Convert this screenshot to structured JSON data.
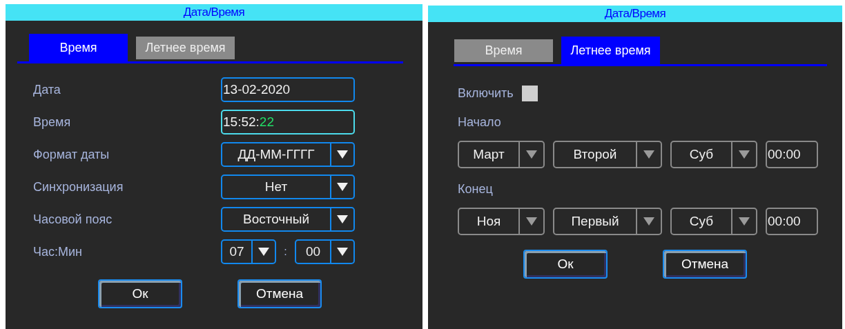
{
  "panels": [
    {
      "kind": "time",
      "title": "Дата/Время",
      "tabs": [
        {
          "label": "Время",
          "selected": true
        },
        {
          "label": "Летнее время",
          "selected": false
        }
      ],
      "fields": [
        {
          "label": "Дата",
          "kind": "text",
          "value": "13-02-2020",
          "focused": false
        },
        {
          "label": "Время",
          "kind": "text",
          "value": "15:52:",
          "active_segment": "22",
          "focused": true
        },
        {
          "label": "Формат даты",
          "kind": "select",
          "value": "ДД-ММ-ГГГГ",
          "focused": false
        },
        {
          "label": "Синхронизация",
          "kind": "select",
          "value": "Нет",
          "focused": false
        },
        {
          "label": "Часовой пояс",
          "kind": "select",
          "value": "Восточный",
          "focused": false
        },
        {
          "label": "Час:Мин",
          "kind": "pair",
          "values": [
            "07",
            "00"
          ],
          "separator": ":",
          "focused": false
        }
      ],
      "buttons": [
        "Ок",
        "Отмена"
      ]
    },
    {
      "kind": "dst",
      "title": "Дата/Время",
      "tabs": [
        {
          "label": "Время",
          "selected": false
        },
        {
          "label": "Летнее время",
          "selected": true
        }
      ],
      "enable": {
        "label": "Включить",
        "checked": false
      },
      "groups": [
        {
          "label": "Начало",
          "selects": [
            "Март",
            "Второй",
            "Суб"
          ],
          "time": "00:00"
        },
        {
          "label": "Конец",
          "selects": [
            "Ноя",
            "Первый",
            "Суб"
          ],
          "time": "00:00"
        }
      ],
      "buttons": [
        "Ок",
        "Отмена"
      ]
    }
  ]
}
